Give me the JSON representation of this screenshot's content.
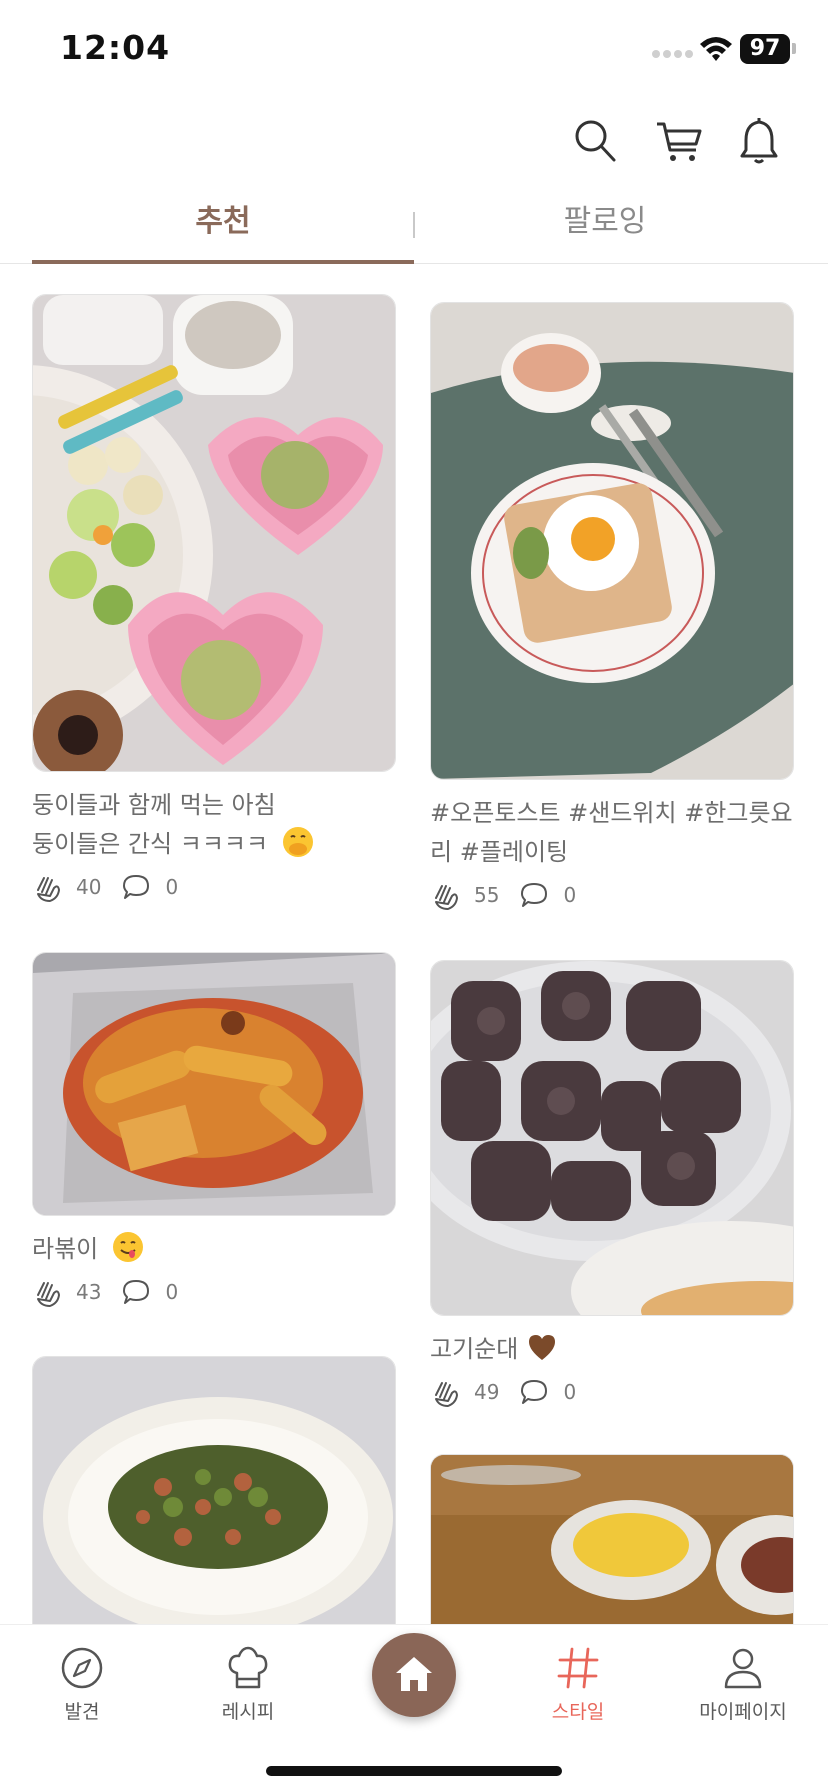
{
  "status_bar": {
    "time": "12:04",
    "battery": "97"
  },
  "header": {
    "icons": [
      "search-icon",
      "cart-icon",
      "bell-icon"
    ]
  },
  "tabs": [
    {
      "label": "추천",
      "active": true
    },
    {
      "label": "팔로잉",
      "active": false
    }
  ],
  "feed": {
    "cards": [
      {
        "caption_line1": "둥이들과 함께 먹는 아침",
        "caption_line2": "둥이들은 간식 ㅋㅋㅋㅋ",
        "emoji": "face-hand-over-mouth",
        "claps": "40",
        "comments": "0"
      },
      {
        "caption_line1": "#오픈토스트 #샌드위치 #한그릇요",
        "caption_line2": "리 #플레이팅",
        "claps": "55",
        "comments": "0"
      },
      {
        "caption_line1": "라볶이",
        "emoji": "face-savoring-food",
        "claps": "43",
        "comments": "0"
      },
      {
        "caption_line1": "고기순대",
        "emoji": "brown-heart",
        "claps": "49",
        "comments": "0"
      }
    ]
  },
  "bottom_nav": {
    "items": [
      {
        "label": "발견",
        "icon": "compass-icon"
      },
      {
        "label": "레시피",
        "icon": "chef-hat-icon"
      },
      {
        "label": "스타일",
        "icon": "hashtag-icon",
        "active": true
      },
      {
        "label": "마이페이지",
        "icon": "person-icon"
      }
    ],
    "home_icon": "home-icon"
  },
  "colors": {
    "accent": "#8a6a5a",
    "active_nav": "#e8665a",
    "home_button": "#8a6657"
  }
}
